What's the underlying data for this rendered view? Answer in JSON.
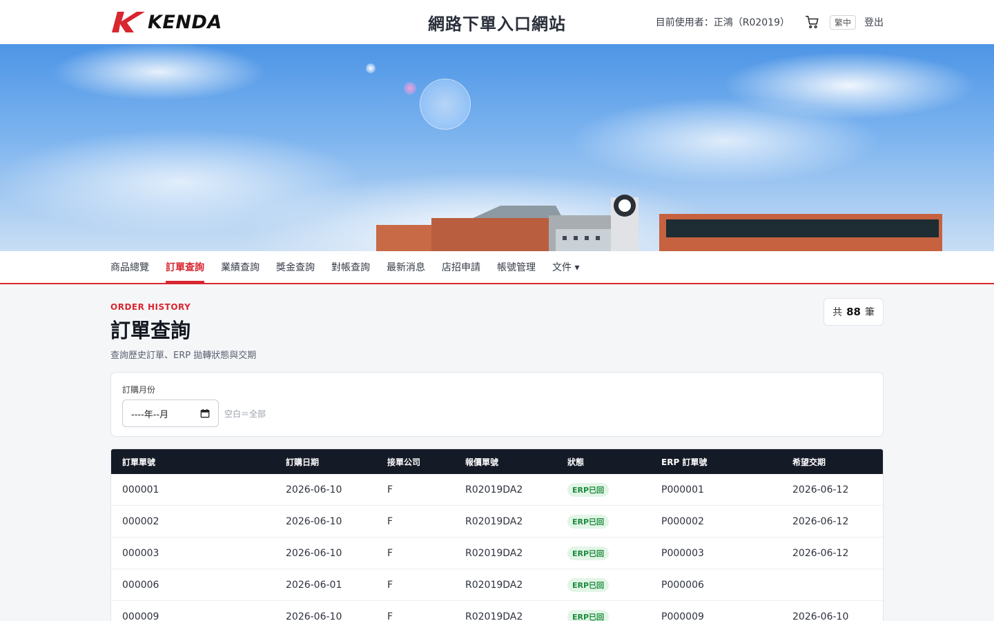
{
  "header": {
    "logo_text": "KENDA",
    "site_title": "網路下單入口網站",
    "current_user": "目前使用者：正鴻（R02019）",
    "lang_label": "繁中",
    "logout_label": "登出"
  },
  "nav": {
    "items": [
      {
        "label": "商品總覽"
      },
      {
        "label": "訂單查詢"
      },
      {
        "label": "業績查詢"
      },
      {
        "label": "獎金查詢"
      },
      {
        "label": "對帳查詢"
      },
      {
        "label": "最新消息"
      },
      {
        "label": "店招申請"
      },
      {
        "label": "帳號管理"
      },
      {
        "label": "文件 ▾"
      }
    ]
  },
  "page": {
    "eyebrow": "ORDER HISTORY",
    "title": "訂單查詢",
    "subtitle": "查詢歷史訂單、ERP 拋轉狀態與交期",
    "count_prefix": "共",
    "count_value": "88",
    "count_suffix": "筆"
  },
  "filter": {
    "label": "訂購月份",
    "month_value": "----年--月",
    "hint": "空白＝全部"
  },
  "table": {
    "headers": [
      "訂單單號",
      "訂購日期",
      "接單公司",
      "報價單號",
      "狀態",
      "ERP 訂單號",
      "希望交期"
    ],
    "rows": [
      {
        "order_no": "000001",
        "date": "2026-06-10",
        "company": "F",
        "quote_no": "R02019DA2",
        "status": "ERP已回",
        "erp_no": "P000001",
        "delivery": "2026-06-12"
      },
      {
        "order_no": "000002",
        "date": "2026-06-10",
        "company": "F",
        "quote_no": "R02019DA2",
        "status": "ERP已回",
        "erp_no": "P000002",
        "delivery": "2026-06-12"
      },
      {
        "order_no": "000003",
        "date": "2026-06-10",
        "company": "F",
        "quote_no": "R02019DA2",
        "status": "ERP已回",
        "erp_no": "P000003",
        "delivery": "2026-06-12"
      },
      {
        "order_no": "000006",
        "date": "2026-06-01",
        "company": "F",
        "quote_no": "R02019DA2",
        "status": "ERP已回",
        "erp_no": "P000006",
        "delivery": ""
      },
      {
        "order_no": "000009",
        "date": "2026-06-10",
        "company": "F",
        "quote_no": "R02019DA2",
        "status": "ERP已回",
        "erp_no": "P000009",
        "delivery": "2026-06-10"
      }
    ]
  },
  "colors": {
    "brand_red": "#d8262f",
    "table_header": "#151a27",
    "status_green": "#1d8a3e"
  },
  "icons": [
    "kenda-logo-icon",
    "cart-icon",
    "calendar-icon"
  ]
}
